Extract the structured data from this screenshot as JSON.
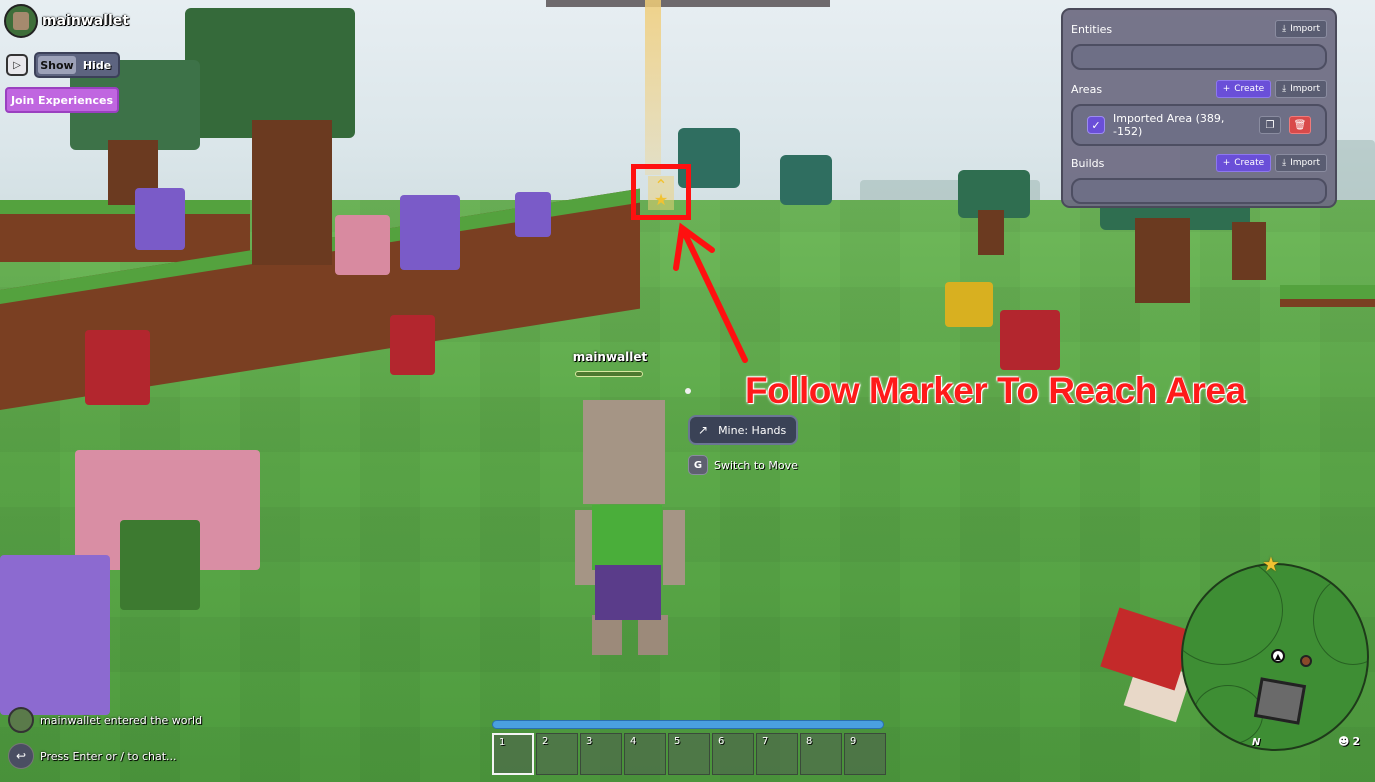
{
  "player": {
    "name": "mainwallet",
    "nameplate": "mainwallet"
  },
  "hud": {
    "play_icon": "play-icon",
    "toggle": {
      "show_label": "Show",
      "hide_label": "Hide",
      "active": "Show"
    },
    "join_label": "Join Experiences"
  },
  "panel": {
    "entities_label": "Entities",
    "areas_label": "Areas",
    "builds_label": "Builds",
    "import_label": "Import",
    "create_label": "Create",
    "areas": [
      {
        "name": "Imported Area (389, -152)",
        "checked": true
      }
    ],
    "accent_color": "#6a4fd8",
    "delete_color": "#d94a4a"
  },
  "marker": {
    "icon": "star-marker-icon"
  },
  "annotation": {
    "text": "Follow Marker To Reach Area",
    "color": "#ff1a1a"
  },
  "actions": {
    "mine_label": "Mine: Hands",
    "switch_key": "G",
    "switch_label": "Switch to Move"
  },
  "chat": {
    "message": "mainwallet entered the world",
    "placeholder": "Press Enter or / to chat..."
  },
  "hotbar": {
    "slots": [
      "1",
      "2",
      "3",
      "4",
      "5",
      "6",
      "7",
      "8",
      "9"
    ],
    "active_slot": "1"
  },
  "minimap": {
    "north_label": "N",
    "online_count": "2"
  }
}
